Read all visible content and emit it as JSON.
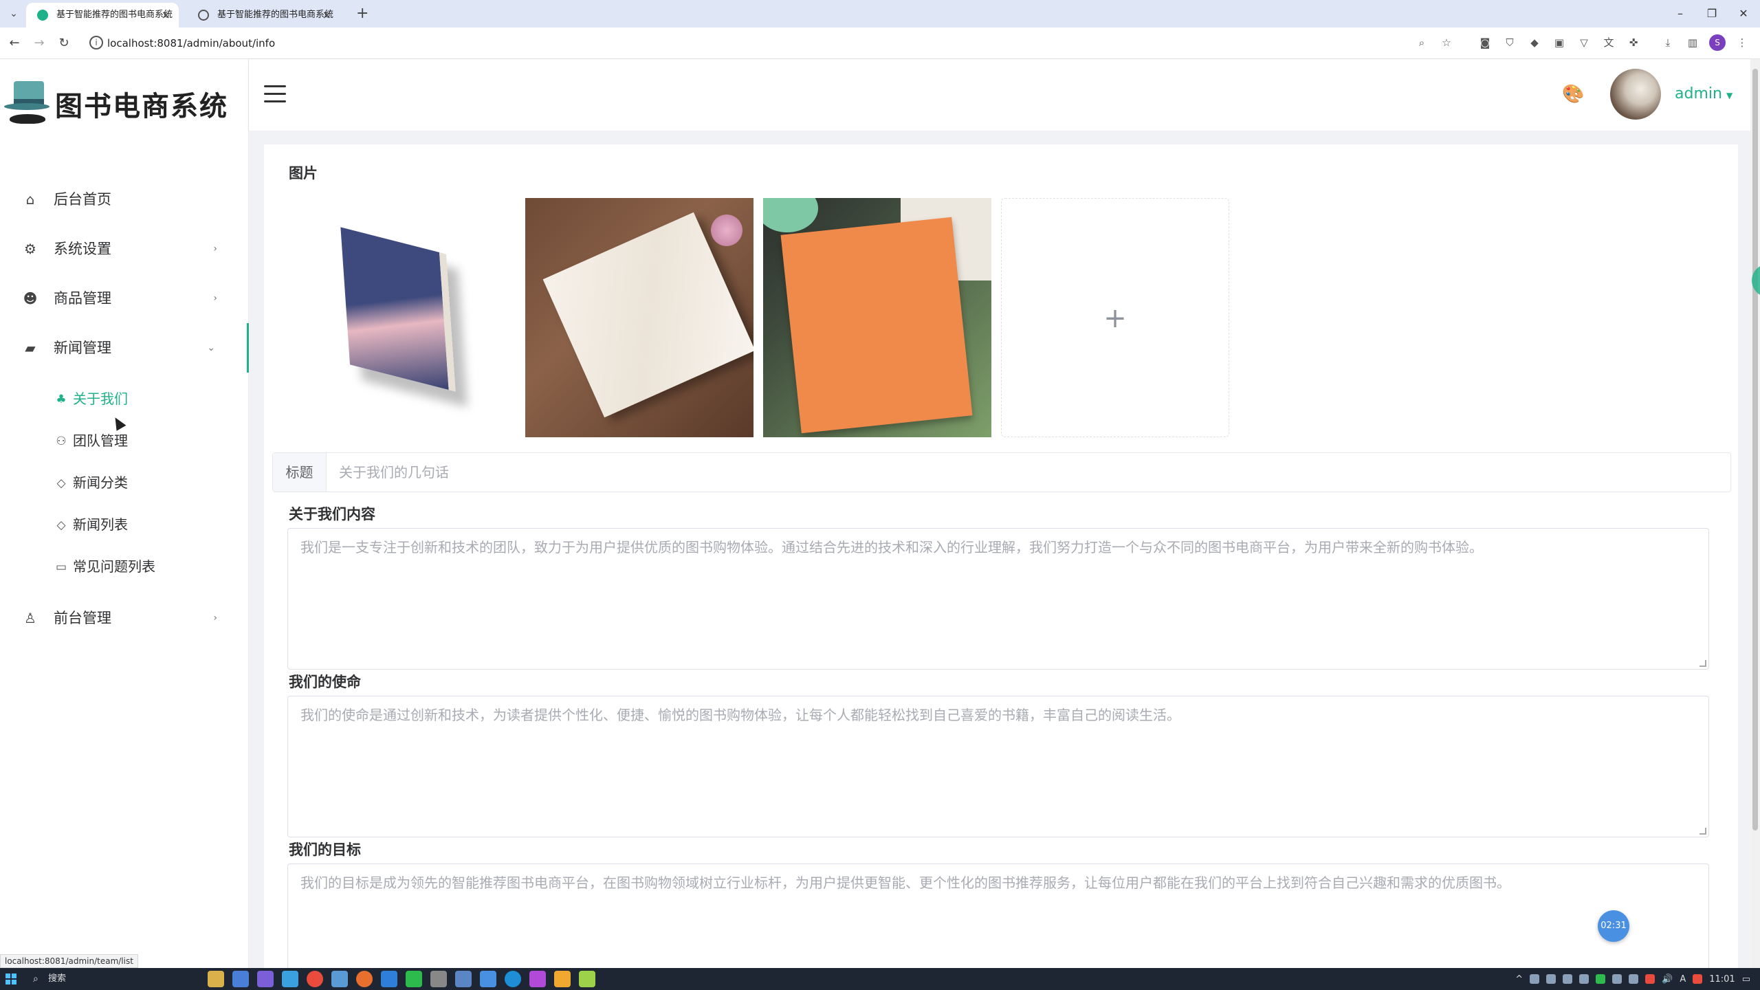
{
  "browser": {
    "tabs": [
      {
        "title": "基于智能推荐的图书电商系统",
        "active": true
      },
      {
        "title": "基于智能推荐的图书电商系统",
        "active": false
      }
    ],
    "url": "localhost:8081/admin/about/info",
    "status_url": "localhost:8081/admin/team/list",
    "profile_initial": "S"
  },
  "app": {
    "logo_text": "图书电商系统",
    "accent_color": "#1fb18a",
    "user": "admin"
  },
  "sidebar": {
    "items": [
      {
        "label": "后台首页",
        "icon": "home-icon"
      },
      {
        "label": "系统设置",
        "icon": "gear-icon"
      },
      {
        "label": "商品管理",
        "icon": "panda-icon"
      },
      {
        "label": "新闻管理",
        "icon": "news-icon"
      },
      {
        "label": "前台管理",
        "icon": "user-icon"
      }
    ],
    "news_sub": [
      {
        "label": "关于我们",
        "icon": "team-icon",
        "active": true
      },
      {
        "label": "团队管理",
        "icon": "people-icon"
      },
      {
        "label": "新闻分类",
        "icon": "tag-icon"
      },
      {
        "label": "新闻列表",
        "icon": "tag-icon"
      },
      {
        "label": "常见问题列表",
        "icon": "chat-icon"
      }
    ]
  },
  "form": {
    "images_label": "图片",
    "upload_symbol": "+",
    "title_label": "标题",
    "title_placeholder": "关于我们的几句话",
    "content_label": "关于我们内容",
    "content_placeholder": "我们是一支专注于创新和技术的团队，致力于为用户提供优质的图书购物体验。通过结合先进的技术和深入的行业理解，我们努力打造一个与众不同的图书电商平台，为用户带来全新的购书体验。",
    "mission_label": "我们的使命",
    "mission_placeholder": "我们的使命是通过创新和技术，为读者提供个性化、便捷、愉悦的图书购物体验，让每个人都能轻松找到自己喜爱的书籍，丰富自己的阅读生活。",
    "goal_label": "我们的目标",
    "goal_placeholder": "我们的目标是成为领先的智能推荐图书电商平台，在图书购物领域树立行业标杆，为用户提供更智能、更个性化的图书推荐服务，让每位用户都能在我们的平台上找到符合自己兴趣和需求的优质图书。"
  },
  "timer_badge": "02:31",
  "taskbar": {
    "search_label": "搜索",
    "clock": "11:01"
  }
}
